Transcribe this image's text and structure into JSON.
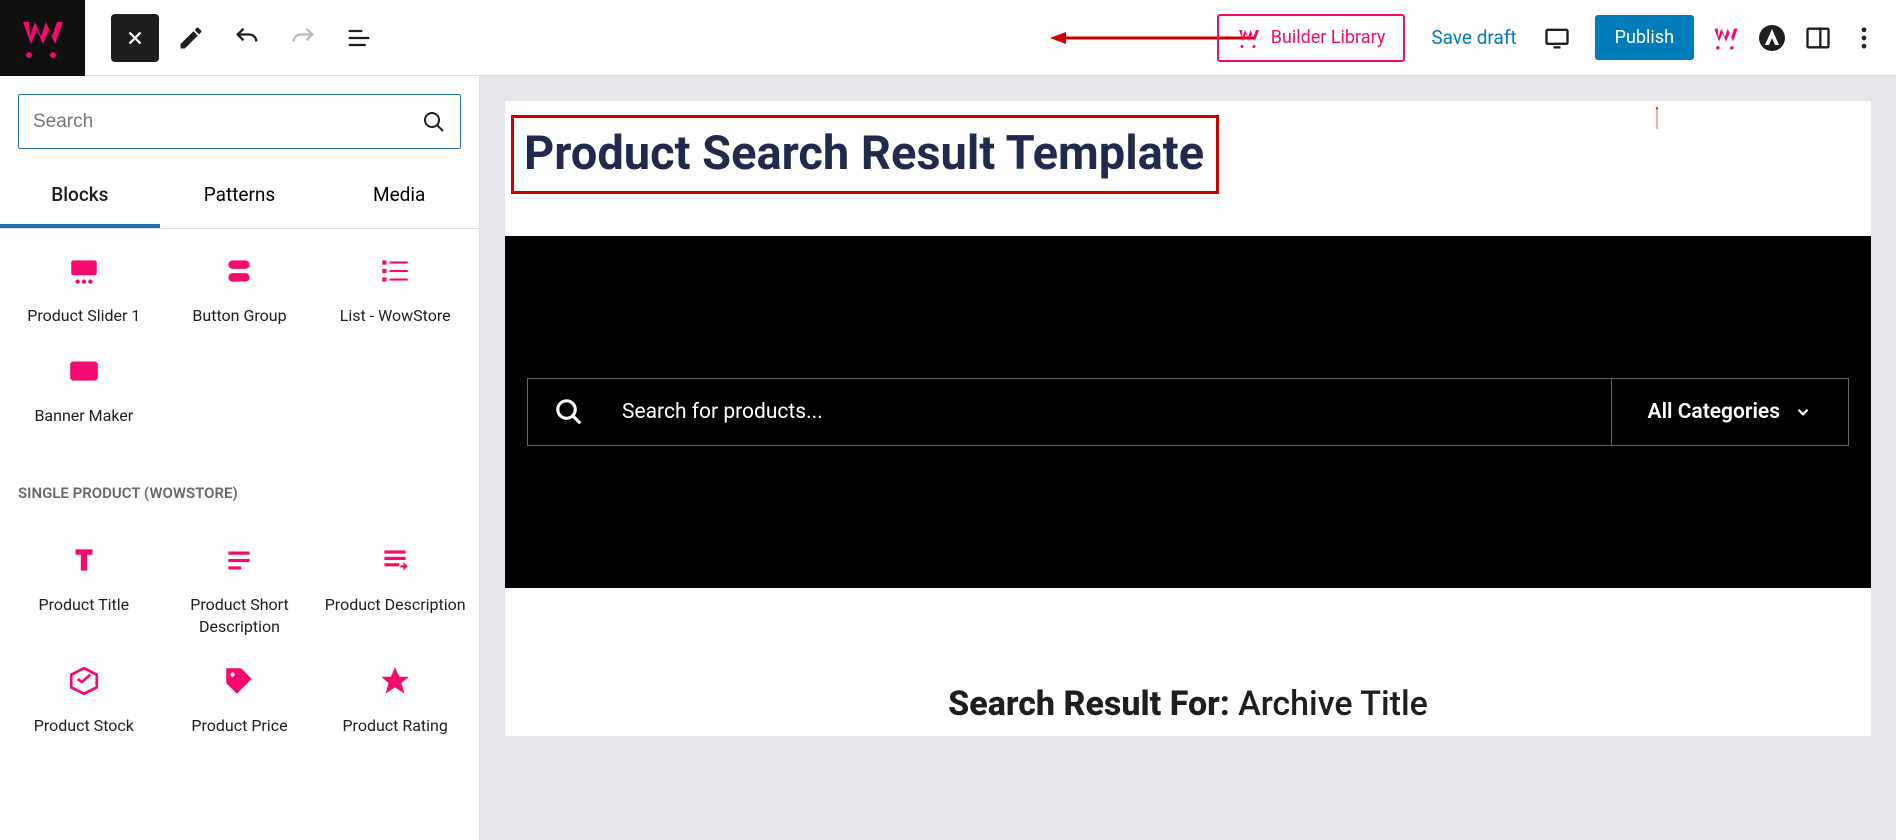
{
  "toolbar": {
    "builder_library": "Builder Library",
    "save_draft": "Save draft",
    "publish": "Publish"
  },
  "sidebar": {
    "search_placeholder": "Search",
    "tabs": {
      "blocks": "Blocks",
      "patterns": "Patterns",
      "media": "Media"
    },
    "section1_items": [
      {
        "label": "Product Slider 1",
        "icon": "slider"
      },
      {
        "label": "Button Group",
        "icon": "button-group"
      },
      {
        "label": "List - WowStore",
        "icon": "list"
      },
      {
        "label": "Banner Maker",
        "icon": "banner"
      }
    ],
    "section2_title": "SINGLE PRODUCT (WOWSTORE)",
    "section2_items": [
      {
        "label": "Product Title",
        "icon": "title"
      },
      {
        "label": "Product Short Description",
        "icon": "short-desc"
      },
      {
        "label": "Product Description",
        "icon": "desc"
      },
      {
        "label": "Product Stock",
        "icon": "stock"
      },
      {
        "label": "Product Price",
        "icon": "price"
      },
      {
        "label": "Product Rating",
        "icon": "rating"
      }
    ]
  },
  "canvas": {
    "page_title": "Product Search Result Template",
    "search_placeholder": "Search for products...",
    "category": "All Categories",
    "result_prefix": "Search Result For:",
    "result_value": "Archive Title"
  }
}
